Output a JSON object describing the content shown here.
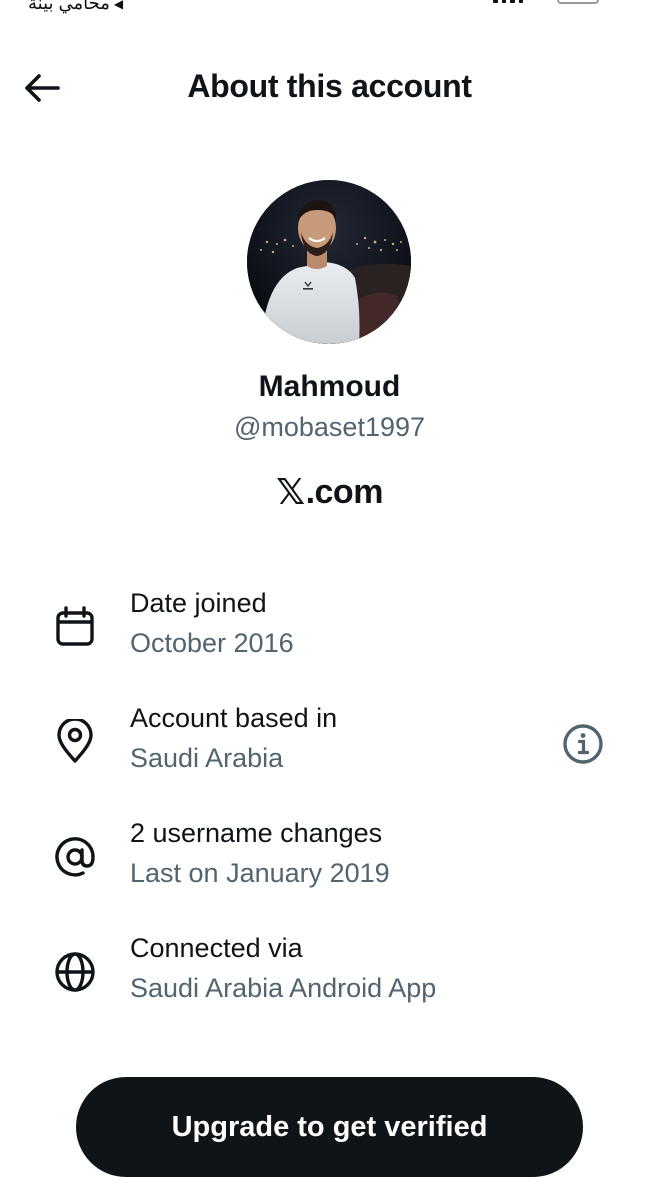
{
  "status_bar": {
    "back_to_app": "محامي بينة",
    "back_arrow_icon": "triangle-left-icon",
    "signal_icon": "signal-icon",
    "battery_icon": "battery-icon"
  },
  "header": {
    "title": "About this account",
    "back_icon": "arrow-left-icon"
  },
  "profile": {
    "name": "Mahmoud",
    "handle": "@mobaset1997",
    "site_x": "𝕏",
    "site_rest": ".com",
    "avatar_icon": "profile-photo"
  },
  "details": [
    {
      "icon": "calendar-icon",
      "label": "Date joined",
      "value": "October 2016"
    },
    {
      "icon": "location-pin-icon",
      "label": "Account based in",
      "value": "Saudi Arabia",
      "trailing_icon": "info-icon"
    },
    {
      "icon": "at-sign-icon",
      "label": "2 username changes",
      "value": "Last on January 2019"
    },
    {
      "icon": "globe-icon",
      "label": "Connected via",
      "value": "Saudi Arabia Android App"
    }
  ],
  "cta": {
    "label": "Upgrade to get verified"
  },
  "colors": {
    "text_primary": "#0f1419",
    "text_secondary": "#536471",
    "button_bg": "#0f1419",
    "button_text": "#ffffff",
    "background": "#ffffff"
  }
}
